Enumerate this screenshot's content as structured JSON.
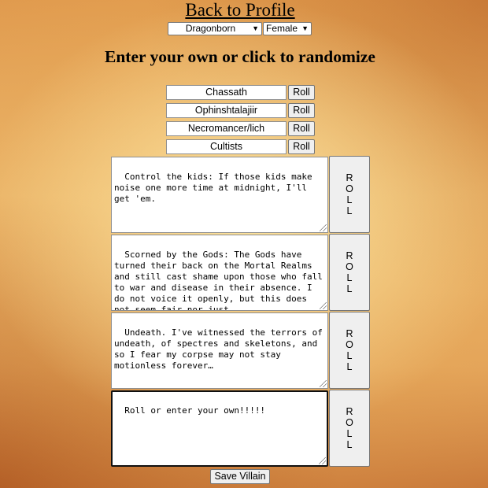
{
  "nav": {
    "back_label": "Back to Profile"
  },
  "selects": {
    "race": {
      "value": "Dragonborn"
    },
    "gender": {
      "value": "Female"
    }
  },
  "heading": "Enter your own or click to randomize",
  "fields": [
    {
      "value": "Chassath",
      "button": "Roll"
    },
    {
      "value": "Ophinshtalajiir",
      "button": "Roll"
    },
    {
      "value": "Necromancer/lich",
      "button": "Roll"
    },
    {
      "value": "Cultists",
      "button": "Roll"
    }
  ],
  "textareas": [
    {
      "value": "Control the kids: If those kids make noise one more time at midnight, I'll get 'em.",
      "button": "ROLL"
    },
    {
      "value": "Scorned by the Gods: The Gods have turned their back on the Mortal Realms and still cast shame upon those who fall to war and disease in their absence. I do not voice it openly, but this does not seem fair nor just.",
      "button": "ROLL"
    },
    {
      "value": "Undeath. I've witnessed the terrors of undeath, of spectres and skeletons, and so I fear my corpse may not stay motionless forever…",
      "button": "ROLL"
    },
    {
      "value": "Roll or enter your own!!!!!",
      "button": "ROLL"
    }
  ],
  "save_label": "Save Villain"
}
